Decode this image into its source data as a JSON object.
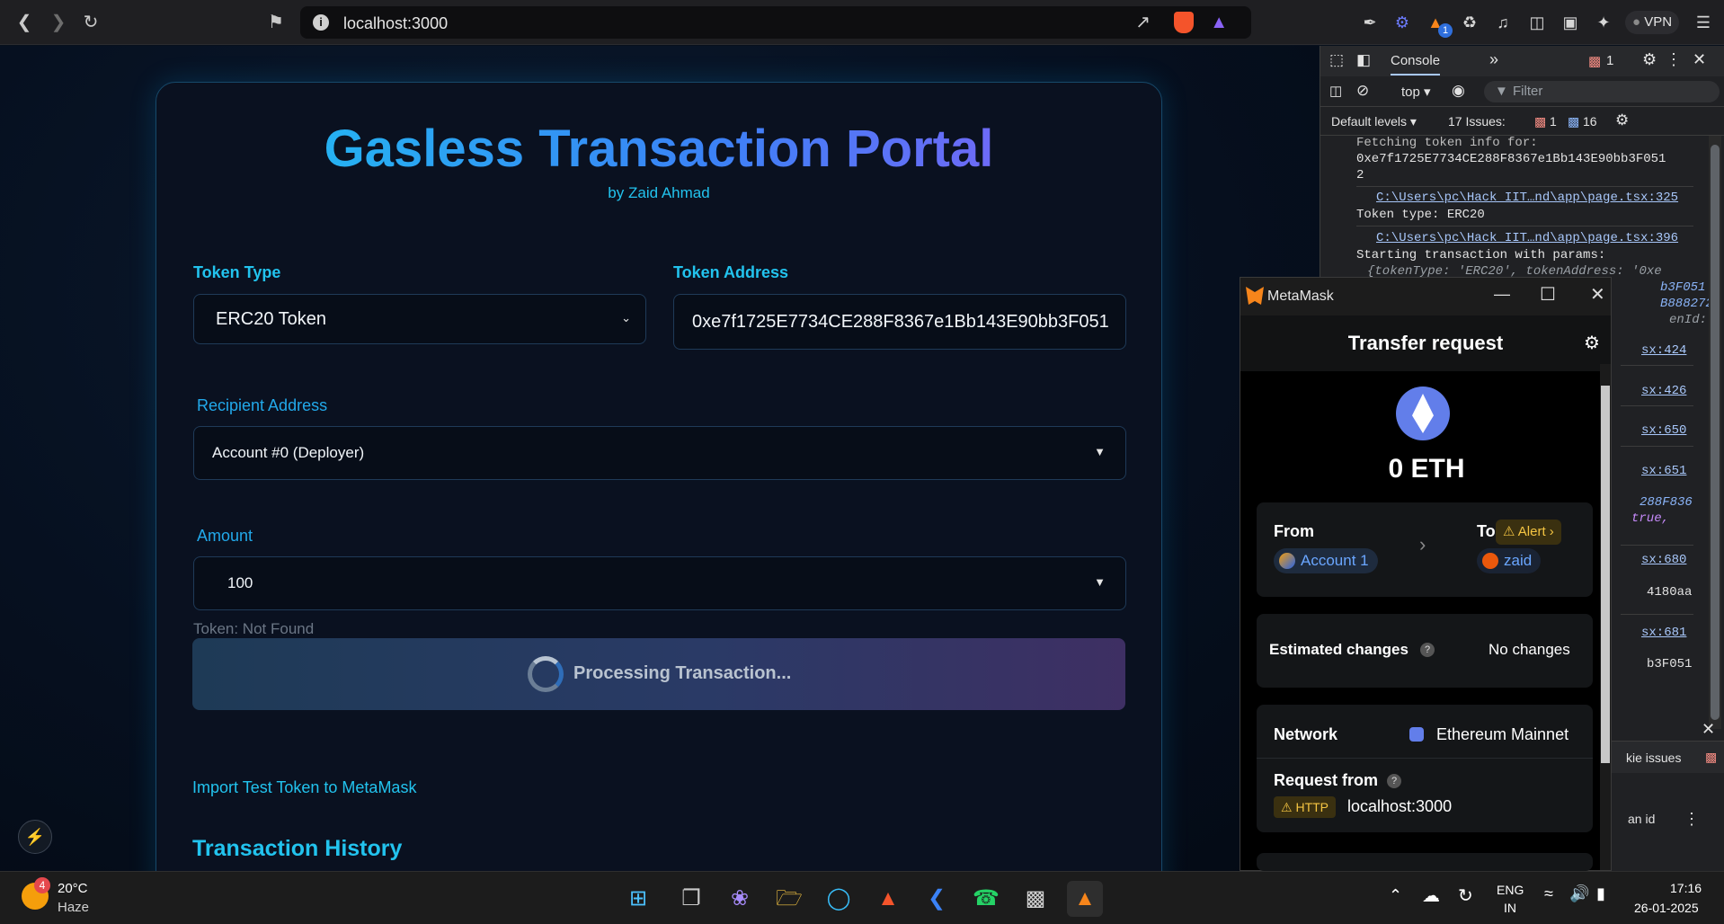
{
  "browser": {
    "url": "localhost:3000",
    "vpn_label": "VPN",
    "extension_badge": "1"
  },
  "app": {
    "title": "Gasless Transaction Portal",
    "byline": "by Zaid Ahmad",
    "token_type_label": "Token Type",
    "token_type_value": "ERC20 Token",
    "token_address_label": "Token Address",
    "token_address_value": "0xe7f1725E7734CE288F8367e1Bb143E90bb3F051",
    "recipient_label": "Recipient Address",
    "recipient_value": "Account #0 (Deployer)",
    "amount_label": "Amount",
    "amount_value": "100",
    "token_status": "Token: Not Found",
    "process_button": "Processing Transaction...",
    "import_link": "Import Test Token to MetaMask",
    "history_title": "Transaction History"
  },
  "devtools": {
    "tab_console": "Console",
    "error_count": "1",
    "context": "top",
    "filter_placeholder": "Filter",
    "levels": "Default levels",
    "issues_label": "17 Issues:",
    "issues_errors": "1",
    "issues_info": "16",
    "log_lines": [
      "Fetching token info for:",
      "0xe7f1725E7734CE288F8367e1Bb143E90bb3F051",
      "2"
    ],
    "link1": "C:\\Users\\pc\\Hack_IIT…nd\\app\\page.tsx:325",
    "log_token_type": "Token type: ERC20",
    "link2": "C:\\Users\\pc\\Hack_IIT…nd\\app\\page.tsx:396",
    "log_starting": "Starting transaction with params:",
    "log_params": "{tokenType: 'ERC20', tokenAddress: '0xe",
    "log_params2": "b3F051",
    "log_params3": "B888272",
    "log_params4": "enId:",
    "link_424": "sx:424",
    "link_426": "sx:426",
    "link_650": "sx:650",
    "link_651": "sx:651",
    "log_288": "288F836",
    "log_true": "true,",
    "link_680": "sx:680",
    "log_4180": "4180aa",
    "link_681": "sx:681",
    "log_b3f": "b3F051",
    "bottom_tab": "kie issues",
    "bottom_row": "an id"
  },
  "metamask": {
    "window_title": "MetaMask",
    "header": "Transfer request",
    "amount": "0 ETH",
    "from_label": "From",
    "from_account": "Account 1",
    "to_label": "To",
    "alert_label": "Alert",
    "to_account": "zaid",
    "est_changes_label": "Estimated changes",
    "est_changes_value": "No changes",
    "network_label": "Network",
    "network_value": "Ethereum Mainnet",
    "request_from_label": "Request from",
    "http_badge": "HTTP",
    "request_from_value": "localhost:3000"
  },
  "taskbar": {
    "weather_temp": "20°C",
    "weather_desc": "Haze",
    "weather_badge": "4",
    "lang1": "ENG",
    "lang2": "IN",
    "time": "17:16",
    "date": "26-01-2025"
  }
}
